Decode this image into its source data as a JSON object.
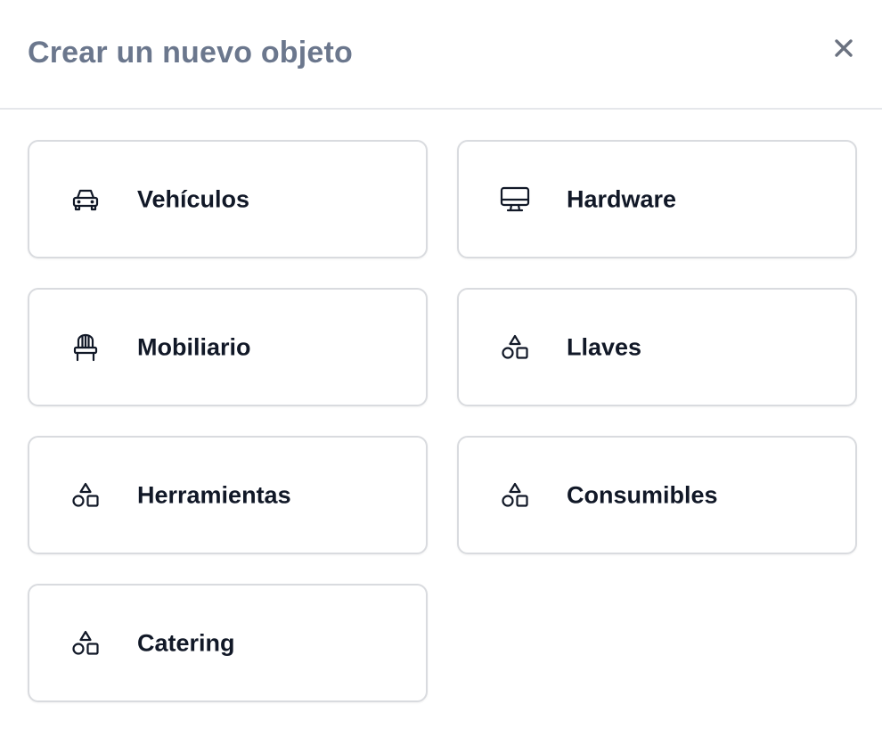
{
  "modal": {
    "title": "Crear un nuevo objeto",
    "close_icon": "close-icon"
  },
  "categories": [
    {
      "label": "Vehículos",
      "icon": "car-icon"
    },
    {
      "label": "Hardware",
      "icon": "monitor-icon"
    },
    {
      "label": "Mobiliario",
      "icon": "chair-icon"
    },
    {
      "label": "Llaves",
      "icon": "shapes-icon"
    },
    {
      "label": "Herramientas",
      "icon": "shapes-icon"
    },
    {
      "label": "Consumibles",
      "icon": "shapes-icon"
    },
    {
      "label": "Catering",
      "icon": "shapes-icon"
    }
  ],
  "colors": {
    "title": "#6b778d",
    "label": "#111827",
    "border": "#d9dbdf",
    "icon": "#111827",
    "close": "#6b7280"
  }
}
